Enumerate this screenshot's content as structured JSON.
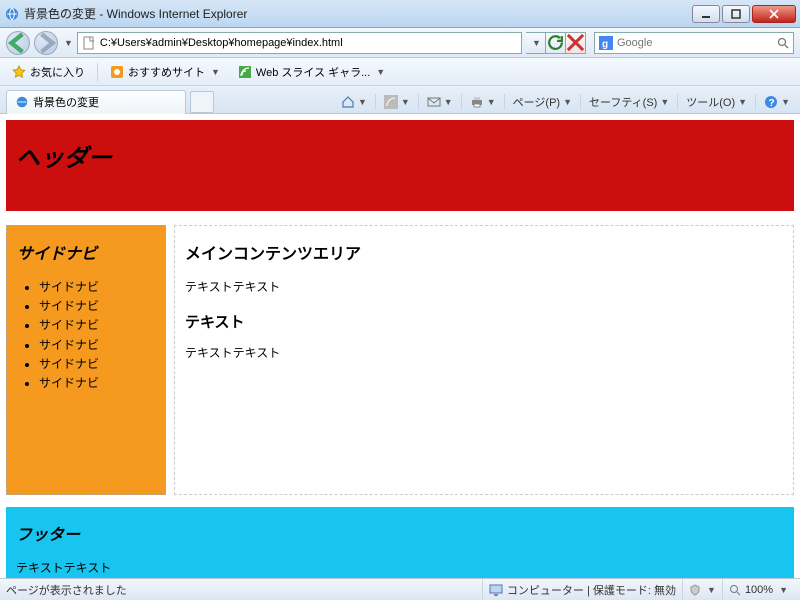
{
  "window": {
    "title": "背景色の変更 - Windows Internet Explorer"
  },
  "address": {
    "url": "C:¥Users¥admin¥Desktop¥homepage¥index.html"
  },
  "search": {
    "placeholder": "Google"
  },
  "favbar": {
    "favorites": "お気に入り",
    "recommended": "おすすめサイト",
    "webslice": "Web スライス ギャラ..."
  },
  "tab": {
    "title": "背景色の変更"
  },
  "cmdbar": {
    "page": "ページ(P)",
    "safety": "セーフティ(S)",
    "tools": "ツール(O)"
  },
  "page": {
    "header": "ヘッダー",
    "sidenav_title": "サイドナビ",
    "sidenav_items": [
      "サイドナビ",
      "サイドナビ",
      "サイドナビ",
      "サイドナビ",
      "サイドナビ",
      "サイドナビ"
    ],
    "main_h2": "メインコンテンツエリア",
    "main_p1": "テキストテキスト",
    "main_h3": "テキスト",
    "main_p2": "テキストテキスト",
    "footer_h2": "フッター",
    "footer_p": "テキストテキスト"
  },
  "status": {
    "left": "ページが表示されました",
    "zone": "コンピューター | 保護モード: 無効",
    "zoom": "100%"
  }
}
